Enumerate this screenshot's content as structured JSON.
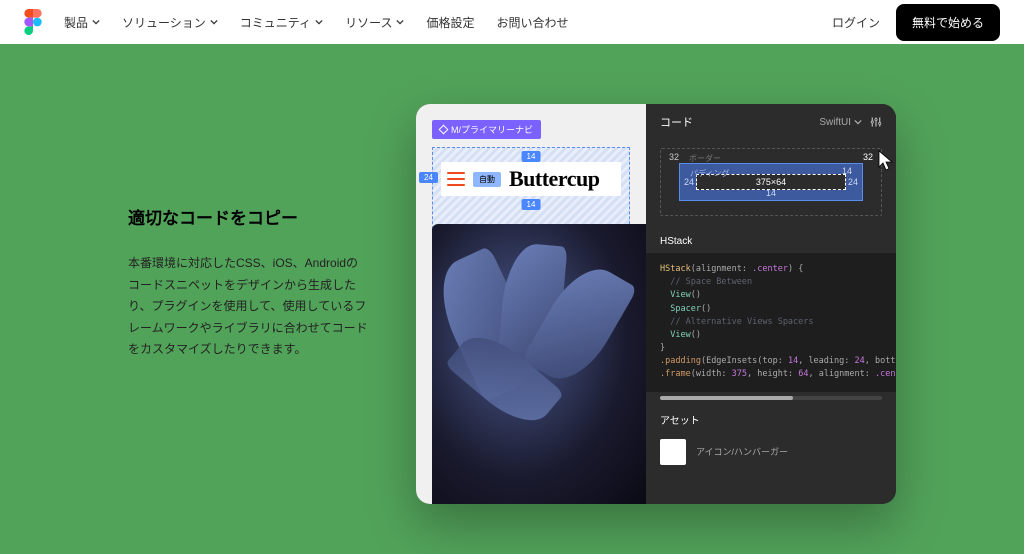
{
  "header": {
    "nav": [
      "製品",
      "ソリューション",
      "コミュニティ",
      "リソース",
      "価格設定",
      "お問い合わせ"
    ],
    "nav_dropdown": [
      true,
      true,
      true,
      true,
      false,
      false
    ],
    "login": "ログイン",
    "cta": "無料で始める"
  },
  "copy": {
    "heading": "適切なコードをコピー",
    "body": "本番環境に対応したCSS、iOS、Androidのコードスニペットをデザインから生成したり、プラグインを使用して、使用しているフレームワークやライブラリに合わせてコードをカスタマイズしたりできます。"
  },
  "canvas": {
    "component_tag": "M/プライマリーナビ",
    "auto_pill": "自動",
    "brand_text": "Buttercup",
    "measure_top": "14",
    "measure_bottom": "14",
    "measure_left": "24"
  },
  "inspect": {
    "panel_title": "コード",
    "lang": "SwiftUI",
    "border_label": "ボーダー",
    "outer_tl": "32",
    "outer_tr": "32",
    "padding_label": "パディング",
    "pad_top": "14",
    "pad_left": "24",
    "pad_right": "24",
    "pad_bottom": "14",
    "size": "375×64",
    "hstack_label": "HStack",
    "code": {
      "l1a": "HStack",
      "l1b": "(alignment: ",
      "l1c": ".center",
      "l1d": ") {",
      "l2": "  // Space Between",
      "l3a": "  View",
      "l3b": "()",
      "l4a": "  Spacer",
      "l4b": "()",
      "l5": "  // Alternative Views Spacers",
      "l6a": "  View",
      "l6b": "()",
      "l7": "}",
      "l8a": ".padding",
      "l8b": "(EdgeInsets(top: ",
      "l8c": "14",
      "l8d": ", leading: ",
      "l8e": "24",
      "l8f": ", bott",
      "l9a": ".frame",
      "l9b": "(width: ",
      "l9c": "375",
      "l9d": ", height: ",
      "l9e": "64",
      "l9f": ", alignment: ",
      "l9g": ".cen"
    },
    "asset_heading": "アセット",
    "asset_name": "アイコン/ハンバーガー"
  }
}
